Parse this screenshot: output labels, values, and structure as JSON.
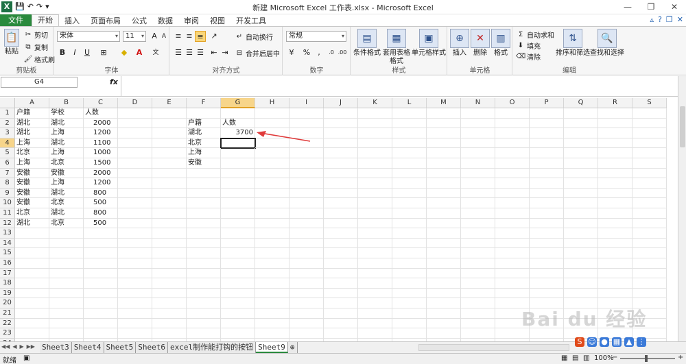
{
  "window": {
    "title": "新建 Microsoft Excel 工作表.xlsx - Microsoft Excel",
    "controls": [
      "—",
      "❐",
      "✕"
    ]
  },
  "ribbon_tabs": [
    "文件",
    "开始",
    "插入",
    "页面布局",
    "公式",
    "数据",
    "审阅",
    "视图",
    "开发工具"
  ],
  "clipboard": {
    "paste": "粘贴",
    "cut": "剪切",
    "copy": "复制",
    "painter": "格式刷",
    "label": "剪贴板"
  },
  "font": {
    "name": "宋体",
    "size": "11",
    "bold": "B",
    "italic": "I",
    "underline": "U",
    "label": "字体"
  },
  "alignment": {
    "wrap": "自动换行",
    "merge": "合并后居中",
    "label": "对齐方式"
  },
  "number": {
    "format": "常规",
    "label": "数字"
  },
  "styles": {
    "conditional": "条件格式",
    "table": "套用表格格式",
    "cell": "单元格样式",
    "label": "样式"
  },
  "cells": {
    "insert": "插入",
    "delete": "删除",
    "format": "格式",
    "label": "单元格"
  },
  "editing": {
    "autosum": "自动求和",
    "fill": "填充",
    "clear": "清除",
    "sort": "排序和筛选",
    "find": "查找和选择",
    "label": "编辑"
  },
  "formula_bar": {
    "name_box": "G4",
    "fx": "fx",
    "value": ""
  },
  "columns": [
    "A",
    "B",
    "C",
    "D",
    "E",
    "F",
    "G",
    "H",
    "I",
    "J",
    "K",
    "L",
    "M",
    "N",
    "O",
    "P",
    "Q",
    "R",
    "S"
  ],
  "selected_column": "G",
  "selected_row": 4,
  "rows": [
    {
      "n": "1",
      "A": "户籍",
      "B": "学校",
      "C": "人数",
      "F": "",
      "G": ""
    },
    {
      "n": "2",
      "A": "湖北",
      "B": "湖北",
      "C": "2000",
      "F": "户籍",
      "G": "人数"
    },
    {
      "n": "3",
      "A": "湖北",
      "B": "上海",
      "C": "1200",
      "F": "湖北",
      "G": "3700"
    },
    {
      "n": "4",
      "A": "上海",
      "B": "湖北",
      "C": "1100",
      "F": "北京",
      "G": ""
    },
    {
      "n": "5",
      "A": "北京",
      "B": "上海",
      "C": "1000",
      "F": "上海",
      "G": ""
    },
    {
      "n": "6",
      "A": "上海",
      "B": "北京",
      "C": "1500",
      "F": "安徽",
      "G": ""
    },
    {
      "n": "7",
      "A": "安徽",
      "B": "安徽",
      "C": "2000",
      "F": "",
      "G": ""
    },
    {
      "n": "8",
      "A": "安徽",
      "B": "上海",
      "C": "1200",
      "F": "",
      "G": ""
    },
    {
      "n": "9",
      "A": "安徽",
      "B": "湖北",
      "C": "800",
      "F": "",
      "G": ""
    },
    {
      "n": "10",
      "A": "安徽",
      "B": "北京",
      "C": "500",
      "F": "",
      "G": ""
    },
    {
      "n": "11",
      "A": "北京",
      "B": "湖北",
      "C": "800",
      "F": "",
      "G": ""
    },
    {
      "n": "12",
      "A": "湖北",
      "B": "北京",
      "C": "500",
      "F": "",
      "G": ""
    },
    {
      "n": "13"
    },
    {
      "n": "14"
    },
    {
      "n": "15"
    },
    {
      "n": "16"
    },
    {
      "n": "17"
    },
    {
      "n": "18"
    },
    {
      "n": "19"
    },
    {
      "n": "20"
    },
    {
      "n": "21"
    },
    {
      "n": "22"
    },
    {
      "n": "23"
    },
    {
      "n": "24"
    }
  ],
  "sheets": [
    "Sheet3",
    "Sheet4",
    "Sheet5",
    "Sheet6",
    "excel制作能打钩的按钮",
    "Sheet9"
  ],
  "active_sheet": "Sheet9",
  "status": {
    "ready": "就绪",
    "zoom": "100%"
  },
  "colors": {
    "file_tab": "#2a8a3d",
    "selected_header": "#f7d58a",
    "arrow": "#e03a3a"
  }
}
